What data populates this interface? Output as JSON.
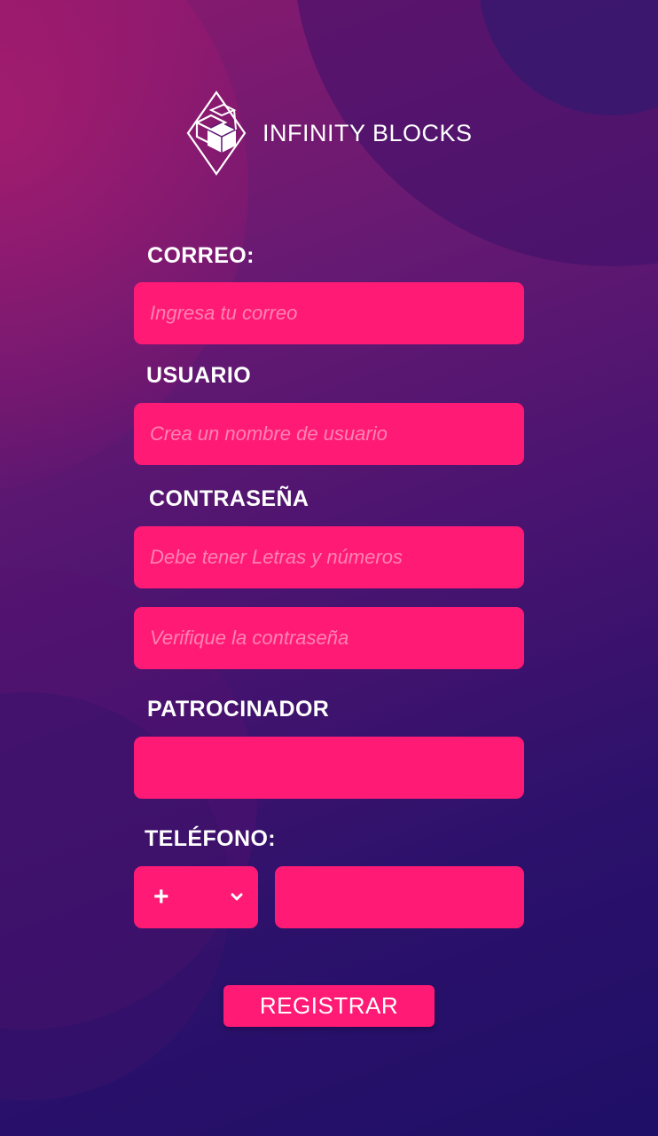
{
  "app": {
    "brand": "INFINITY BLOCKS",
    "logo_icon": "infinity-blocks-logo-icon"
  },
  "colors": {
    "accent": "#ff1a75",
    "background_start": "#8a1a6e",
    "background_end": "#1f0f66",
    "text": "#ffffff"
  },
  "form": {
    "email": {
      "label": "CORREO:",
      "placeholder": "Ingresa tu correo",
      "value": ""
    },
    "username": {
      "label": "USUARIO",
      "placeholder": "Crea un nombre de usuario",
      "value": ""
    },
    "password": {
      "label": "CONTRASEÑA",
      "placeholder": "Debe tener Letras y números",
      "value": ""
    },
    "password_confirm": {
      "placeholder": "Verifique la contraseña",
      "value": ""
    },
    "sponsor": {
      "label": "PATROCINADOR",
      "placeholder": "",
      "value": ""
    },
    "phone": {
      "label": "TELÉFONO:",
      "prefix_symbol": "+",
      "prefix_icon": "chevron-down-icon",
      "number_placeholder": "",
      "number_value": ""
    },
    "submit_label": "REGISTRAR"
  }
}
